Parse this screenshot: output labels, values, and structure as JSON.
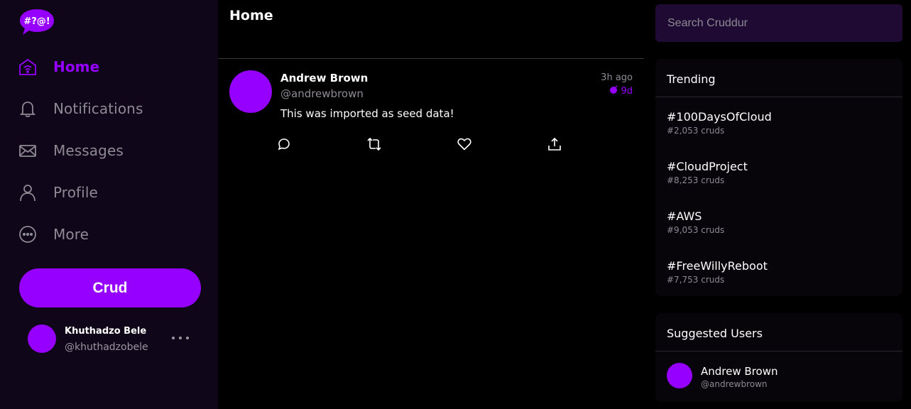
{
  "app": {
    "logo_text": "#?@!",
    "logo_color": "#9500ff"
  },
  "sidebar": {
    "items": [
      {
        "label": "Home",
        "icon": "home-icon",
        "active": true
      },
      {
        "label": "Notifications",
        "icon": "bell-icon",
        "active": false
      },
      {
        "label": "Messages",
        "icon": "envelope-icon",
        "active": false
      },
      {
        "label": "Profile",
        "icon": "person-icon",
        "active": false
      },
      {
        "label": "More",
        "icon": "ellipsis-circle-icon",
        "active": false
      }
    ],
    "crud_label": "Crud",
    "profile": {
      "name": "Khuthadzo Bele",
      "handle": "@khuthadzobele"
    }
  },
  "main": {
    "title": "Home",
    "posts": [
      {
        "name": "Andrew Brown",
        "handle": "@andrewbrown",
        "time": "3h ago",
        "expires": "9d",
        "text": "This was imported as seed data!",
        "actions": [
          "reply-icon",
          "repost-icon",
          "like-icon",
          "share-icon"
        ]
      }
    ]
  },
  "right": {
    "search_placeholder": "Search Cruddur",
    "trending": {
      "title": "Trending",
      "items": [
        {
          "tag": "#100DaysOfCloud",
          "count": "#2,053 cruds"
        },
        {
          "tag": "#CloudProject",
          "count": "#8,253 cruds"
        },
        {
          "tag": "#AWS",
          "count": "#9,053 cruds"
        },
        {
          "tag": "#FreeWillyReboot",
          "count": "#7,753 cruds"
        }
      ]
    },
    "suggested": {
      "title": "Suggested Users",
      "users": [
        {
          "name": "Andrew Brown",
          "handle": "@andrewbrown"
        }
      ]
    }
  },
  "colors": {
    "accent": "#9500ff",
    "sidebar_bg": "#0f0719",
    "search_bg": "#1f0a33",
    "muted_text": "#8e8a94"
  }
}
